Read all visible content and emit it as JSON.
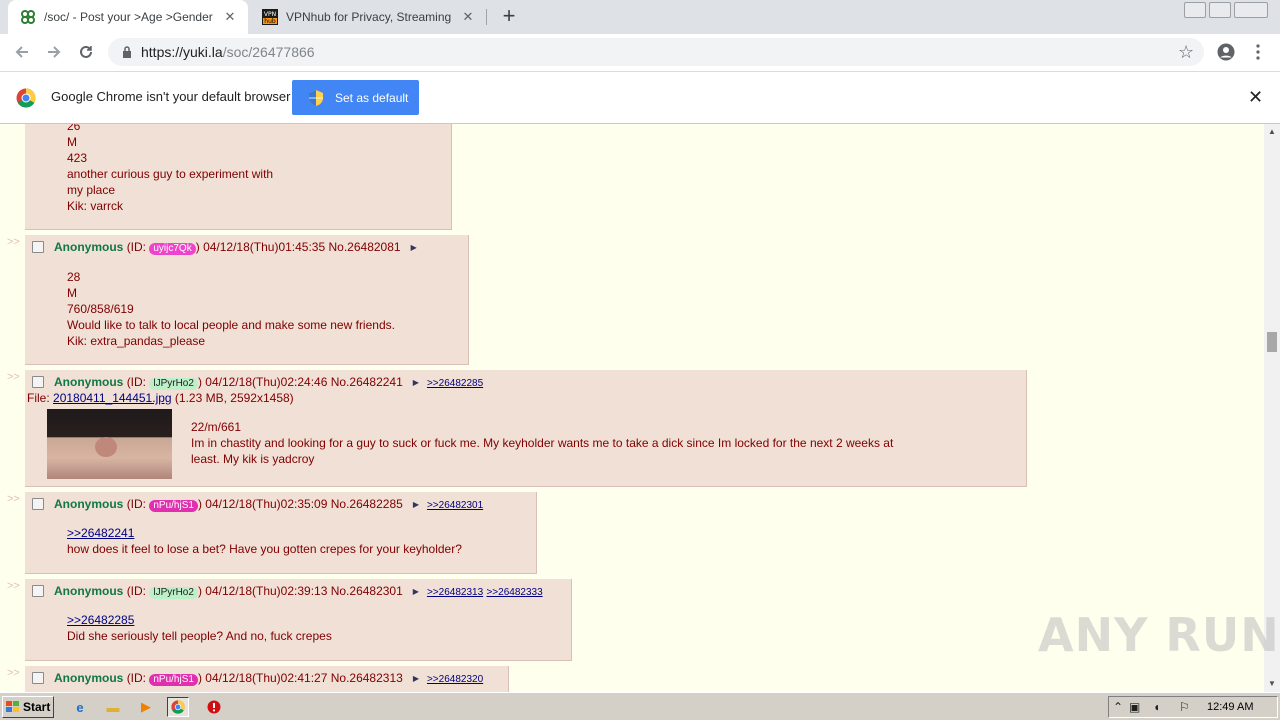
{
  "browser": {
    "tabs": [
      {
        "title": "/soc/ - Post your >Age >Gender >A",
        "active": true
      },
      {
        "title": "VPNhub for Privacy, Streaming and Pr",
        "active": false
      }
    ],
    "url_host": "https://yuki.la",
    "url_path": "/soc/26477866"
  },
  "infobar": {
    "message": "Google Chrome isn't your default browser",
    "button_label": "Set as default"
  },
  "posts": [
    {
      "lines": [
        "26",
        "M",
        "423",
        "another curious guy to experiment with",
        "my place",
        "Kik: varrck"
      ]
    },
    {
      "arrows": ">>",
      "name": "Anonymous",
      "id_prefix": "(ID: ",
      "id": "uyijc7Qk",
      "id_bg": "#ee44cc",
      "id_fg": "#ffffff",
      "id_suffix": ")",
      "datetime": "04/12/18(Thu)01:45:35",
      "number": "No.26482081",
      "backlinks": [],
      "lines": [
        "28",
        "M",
        "760/858/619",
        "Would like to talk to local people and make some new friends.",
        "Kik: extra_pandas_please"
      ]
    },
    {
      "arrows": ">>",
      "name": "Anonymous",
      "id_prefix": "(ID: ",
      "id": "lJPyrHo2",
      "id_bg": "#bbf0c8",
      "id_fg": "#202020",
      "id_suffix": ")",
      "datetime": "04/12/18(Thu)02:24:46",
      "number": "No.26482241",
      "backlinks": [
        ">>26482285"
      ],
      "file_label": "File: ",
      "file_name": "20180411_144451.jpg",
      "file_info": " (1.23 MB, 2592x1458)",
      "lines": [
        "22/m/661",
        "Im in chastity and looking for a guy to suck or fuck me. My keyholder wants me to take a dick since Im locked for the next 2 weeks at",
        "least. My kik is yadcroy"
      ]
    },
    {
      "arrows": ">>",
      "name": "Anonymous",
      "id_prefix": "(ID: ",
      "id": "nPu/hjS1",
      "id_bg": "#e030b0",
      "id_fg": "#ffffff",
      "id_suffix": ")",
      "datetime": "04/12/18(Thu)02:35:09",
      "number": "No.26482285",
      "backlinks": [
        ">>26482301"
      ],
      "quote": ">>26482241",
      "lines": [
        "how does it feel to lose a bet? Have you gotten crepes for your keyholder?"
      ]
    },
    {
      "arrows": ">>",
      "name": "Anonymous",
      "id_prefix": "(ID: ",
      "id": "lJPyrHo2",
      "id_bg": "#bbf0c8",
      "id_fg": "#202020",
      "id_suffix": ")",
      "datetime": "04/12/18(Thu)02:39:13",
      "number": "No.26482301",
      "backlinks": [
        ">>26482313",
        ">>26482333"
      ],
      "quote": ">>26482285",
      "lines": [
        "Did she seriously tell people? And no, fuck crepes"
      ]
    },
    {
      "arrows": ">>",
      "name": "Anonymous",
      "id_prefix": "(ID: ",
      "id": "nPu/hjS1",
      "id_bg": "#e030b0",
      "id_fg": "#ffffff",
      "id_suffix": ")",
      "datetime": "04/12/18(Thu)02:41:27",
      "number": "No.26482313",
      "backlinks": [
        ">>26482320"
      ],
      "lines": []
    }
  ],
  "watermark": "ANY RUN",
  "taskbar": {
    "start_label": "Start",
    "clock": "12:49 AM"
  }
}
